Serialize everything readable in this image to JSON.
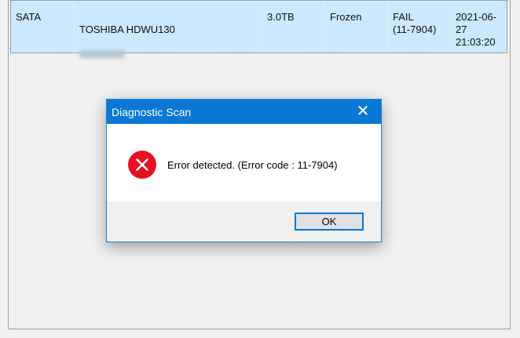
{
  "row": {
    "interface": "SATA",
    "model": "TOSHIBA HDWU130",
    "capacity": "3.0TB",
    "status": "Frozen",
    "result": "FAIL\n(11-7904)",
    "datetime": "2021-06-27\n21:03:20"
  },
  "dialog": {
    "title": "Diagnostic Scan",
    "close_glyph": "✕",
    "message": "Error detected. (Error code : 11-7904)",
    "ok_label": "OK",
    "icon": "error-icon"
  },
  "colors": {
    "title_bar": "#0a78d4",
    "selection": "#cce8ff",
    "error_red": "#e81123"
  }
}
